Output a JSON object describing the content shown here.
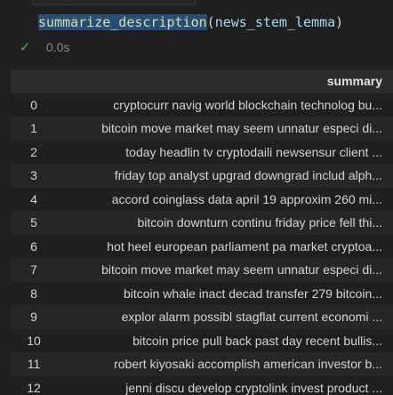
{
  "toolbar": {
    "icons": [
      "run-by-line-icon",
      "split-icon",
      "more-icon"
    ]
  },
  "cell": {
    "code_function": "summarize_description",
    "code_open_paren": "(",
    "code_argument": "news_stem_lemma",
    "code_close_paren": ")",
    "status_icon": "check-icon",
    "exec_time": "0.0s"
  },
  "output": {
    "columns": [
      "",
      "summary"
    ],
    "rows": [
      {
        "index": "0",
        "summary": "cryptocurr navig world blockchain technolog bu..."
      },
      {
        "index": "1",
        "summary": "bitcoin move market may seem unnatur especi di..."
      },
      {
        "index": "2",
        "summary": "today headlin tv cryptodaili newsensur client ..."
      },
      {
        "index": "3",
        "summary": "friday top analyst upgrad downgrad includ alph..."
      },
      {
        "index": "4",
        "summary": "accord coinglass data april 19 approxim 260 mi..."
      },
      {
        "index": "5",
        "summary": "bitcoin downturn continu friday price fell thi..."
      },
      {
        "index": "6",
        "summary": "hot heel european parliament pa market cryptoa..."
      },
      {
        "index": "7",
        "summary": "bitcoin move market may seem unnatur especi di..."
      },
      {
        "index": "8",
        "summary": "bitcoin whale inact decad transfer 279 bitcoin..."
      },
      {
        "index": "9",
        "summary": "explor alarm possibl stagflat current economi ..."
      },
      {
        "index": "10",
        "summary": "bitcoin price pull back past day recent bullis..."
      },
      {
        "index": "11",
        "summary": "robert kiyosaki accomplish american investor b..."
      },
      {
        "index": "12",
        "summary": "jenni discu develop cryptolink invest product ..."
      }
    ]
  }
}
